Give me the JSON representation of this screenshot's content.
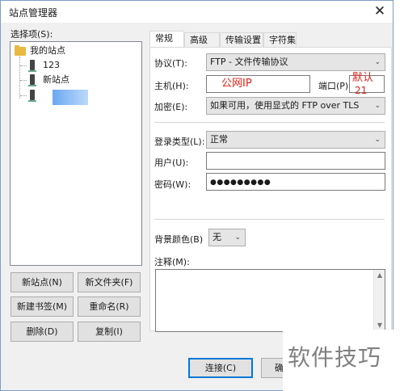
{
  "window": {
    "title": "站点管理器",
    "close_glyph": "✕"
  },
  "tree": {
    "label": "选择项(S):",
    "root": "我的站点",
    "items": [
      "123",
      "新站点"
    ]
  },
  "left_buttons": {
    "new_site": "新站点(N)",
    "new_folder": "新文件夹(F)",
    "new_bookmark": "新建书签(M)",
    "rename": "重命名(R)",
    "delete": "删除(D)",
    "copy": "复制(I)"
  },
  "tabs": [
    "常规",
    "高级",
    "传输设置",
    "字符集"
  ],
  "form": {
    "protocol_label": "协议(T):",
    "protocol_value": "FTP - 文件传输协议",
    "host_label": "主机(H):",
    "host_value": "公网IP",
    "port_label": "端口(P):",
    "port_value_line1": "默认",
    "port_value_line2": "21",
    "encryption_label": "加密(E):",
    "encryption_value": "如果可用，使用显式的 FTP over TLS",
    "logon_type_label": "登录类型(L):",
    "logon_type_value": "正常",
    "user_label": "用户(U):",
    "user_value": "",
    "password_label": "密码(W):",
    "password_value": "●●●●●●●●●",
    "bg_color_label": "背景颜色(B)",
    "bg_color_value": "无",
    "comments_label": "注释(M):"
  },
  "bottom_buttons": {
    "connect": "连接(C)",
    "ok_partial": "确"
  },
  "watermark": "软件技巧",
  "colors": {
    "accent": "#0078d7",
    "annotation_red": "#e0241b",
    "folder": "#e8b940"
  }
}
